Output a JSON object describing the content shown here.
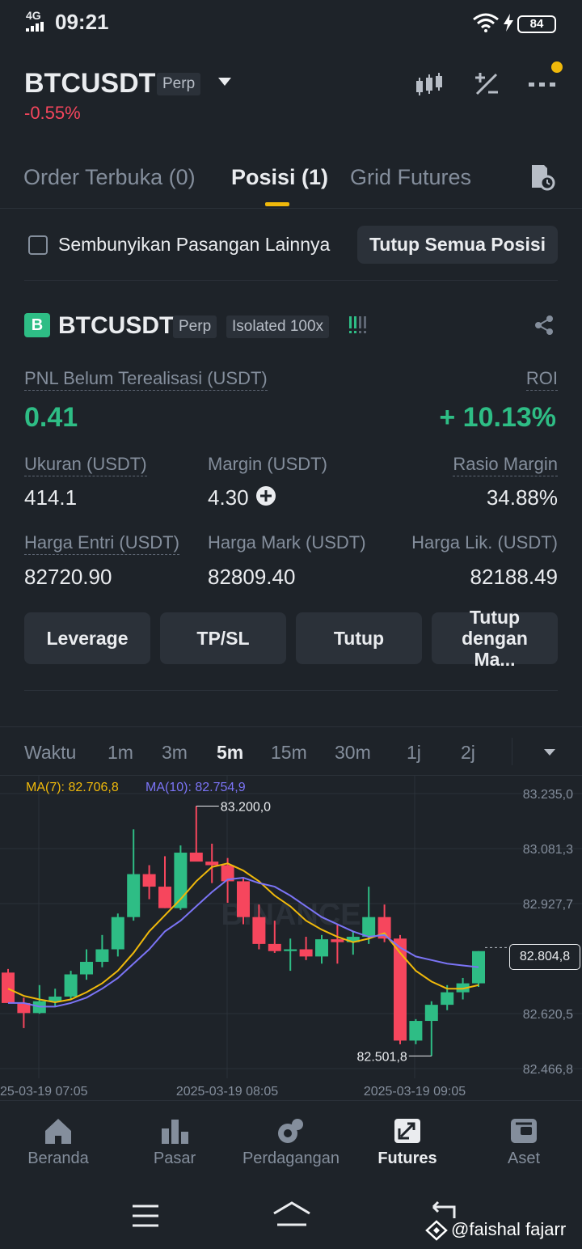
{
  "status_bar": {
    "network": "4G",
    "time": "09:21",
    "battery": "84"
  },
  "header": {
    "pair": "BTCUSDT",
    "type": "Perp",
    "change": "-0.55%"
  },
  "tabs": [
    {
      "label": "Order Terbuka (0)"
    },
    {
      "label": "Posisi (1)"
    },
    {
      "label": "Grid Futures"
    }
  ],
  "filter": {
    "hide_label": "Sembunyikan Pasangan Lainnya",
    "close_all": "Tutup Semua Posisi"
  },
  "position": {
    "side_badge": "B",
    "pair": "BTCUSDT",
    "type": "Perp",
    "margin_mode": "Isolated 100x",
    "pnl_label": "PNL Belum Terealisasi (USDT)",
    "pnl_value": "0.41",
    "roi_label": "ROI",
    "roi_value": "+ 10.13%",
    "size_label": "Ukuran (USDT)",
    "size_value": "414.1",
    "margin_label": "Margin (USDT)",
    "margin_value": "4.30",
    "ratio_label": "Rasio Margin",
    "ratio_value": "34.88%",
    "entry_label": "Harga Entri (USDT)",
    "entry_value": "82720.90",
    "mark_label": "Harga Mark (USDT)",
    "mark_value": "82809.40",
    "liq_label": "Harga Lik. (USDT)",
    "liq_value": "82188.49"
  },
  "actions": {
    "leverage": "Leverage",
    "tpsl": "TP/SL",
    "close": "Tutup",
    "close_market": "Tutup dengan Ma..."
  },
  "timeframes": {
    "label": "Waktu",
    "items": [
      "1m",
      "3m",
      "5m",
      "15m",
      "30m",
      "1j",
      "2j"
    ],
    "active": "5m"
  },
  "chart_data": {
    "type": "candlestick",
    "ma7_label": "MA(7): 82.706,8",
    "ma10_label": "MA(10): 82.754,9",
    "y_ticks": [
      "83.235,0",
      "83.081,3",
      "82.927,7",
      "82.620,5",
      "82.466,8"
    ],
    "ylim": [
      82466.8,
      83235.0
    ],
    "x_labels": [
      "25-03-19 07:05",
      "2025-03-19 08:05",
      "2025-03-19 09:05"
    ],
    "current_price": "82.804,8",
    "high_annotation": "83.200,0",
    "low_annotation": "82.501,8",
    "watermark": "BINANCE",
    "colors": {
      "up": "#2ebd85",
      "down": "#f6465d",
      "ma7": "#f0b90b",
      "ma10": "#7b74f5"
    },
    "candles": [
      {
        "o": 82735,
        "h": 82745,
        "l": 82685,
        "c": 82650
      },
      {
        "o": 82650,
        "h": 82665,
        "l": 82580,
        "c": 82622
      },
      {
        "o": 82622,
        "h": 82700,
        "l": 82620,
        "c": 82655
      },
      {
        "o": 82655,
        "h": 82690,
        "l": 82640,
        "c": 82668
      },
      {
        "o": 82668,
        "h": 82740,
        "l": 82660,
        "c": 82730
      },
      {
        "o": 82730,
        "h": 82800,
        "l": 82715,
        "c": 82765
      },
      {
        "o": 82765,
        "h": 82840,
        "l": 82750,
        "c": 82800
      },
      {
        "o": 82800,
        "h": 82900,
        "l": 82780,
        "c": 82890
      },
      {
        "o": 82890,
        "h": 83135,
        "l": 82880,
        "c": 83010
      },
      {
        "o": 83010,
        "h": 83035,
        "l": 82940,
        "c": 82975
      },
      {
        "o": 82975,
        "h": 83060,
        "l": 82915,
        "c": 82915
      },
      {
        "o": 82915,
        "h": 83090,
        "l": 82910,
        "c": 83070
      },
      {
        "o": 83070,
        "h": 83200,
        "l": 83050,
        "c": 83045
      },
      {
        "o": 83045,
        "h": 83095,
        "l": 82985,
        "c": 83035
      },
      {
        "o": 83035,
        "h": 83055,
        "l": 82930,
        "c": 82990
      },
      {
        "o": 82990,
        "h": 83000,
        "l": 82870,
        "c": 82890
      },
      {
        "o": 82890,
        "h": 82925,
        "l": 82800,
        "c": 82815
      },
      {
        "o": 82815,
        "h": 82880,
        "l": 82790,
        "c": 82795
      },
      {
        "o": 82795,
        "h": 82830,
        "l": 82740,
        "c": 82800
      },
      {
        "o": 82800,
        "h": 82835,
        "l": 82770,
        "c": 82780
      },
      {
        "o": 82780,
        "h": 82840,
        "l": 82760,
        "c": 82828
      },
      {
        "o": 82828,
        "h": 82870,
        "l": 82760,
        "c": 82820
      },
      {
        "o": 82820,
        "h": 82850,
        "l": 82785,
        "c": 82835
      },
      {
        "o": 82835,
        "h": 82975,
        "l": 82815,
        "c": 82890
      },
      {
        "o": 82890,
        "h": 82925,
        "l": 82820,
        "c": 82830
      },
      {
        "o": 82830,
        "h": 82840,
        "l": 82535,
        "c": 82545
      },
      {
        "o": 82545,
        "h": 82605,
        "l": 82535,
        "c": 82600
      },
      {
        "o": 82600,
        "h": 82655,
        "l": 82502,
        "c": 82645
      },
      {
        "o": 82645,
        "h": 82700,
        "l": 82630,
        "c": 82680
      },
      {
        "o": 82680,
        "h": 82720,
        "l": 82660,
        "c": 82705
      },
      {
        "o": 82705,
        "h": 82795,
        "l": 82695,
        "c": 82795
      }
    ],
    "ma7": [
      82690,
      82670,
      82660,
      82652,
      82660,
      82680,
      82705,
      82740,
      82790,
      82850,
      82895,
      82940,
      82990,
      83030,
      83040,
      83020,
      82990,
      82950,
      82920,
      82880,
      82855,
      82835,
      82820,
      82830,
      82845,
      82790,
      82740,
      82710,
      82690,
      82690,
      82700
    ],
    "ma10": [
      82650,
      82650,
      82640,
      82640,
      82650,
      82665,
      82690,
      82720,
      82760,
      82800,
      82850,
      82880,
      82920,
      82960,
      82995,
      83000,
      82985,
      82975,
      82950,
      82920,
      82890,
      82870,
      82850,
      82835,
      82840,
      82805,
      82780,
      82770,
      82760,
      82755,
      82750
    ]
  },
  "nav": [
    {
      "label": "Beranda"
    },
    {
      "label": "Pasar"
    },
    {
      "label": "Perdagangan"
    },
    {
      "label": "Futures"
    },
    {
      "label": "Aset"
    }
  ],
  "watermark_user": "@faishal fajarr"
}
